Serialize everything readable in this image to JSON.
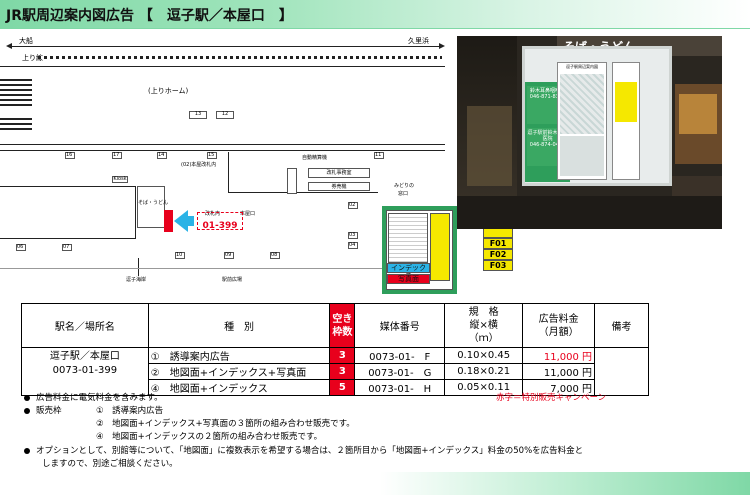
{
  "header": {
    "title": "JR駅周辺案内図広告 【　逗子駅／本屋口　】"
  },
  "map": {
    "dir_left": "大船",
    "dir_right": "久里浜",
    "track_label": "上り線",
    "platform_label": "(上りホーム)",
    "num_12": "12",
    "num_13": "13",
    "num_16": "16",
    "num_17": "17",
    "num_14": "14",
    "num_15": "15",
    "num_11": "11",
    "num_02": "02",
    "num_10": "10",
    "num_09": "09",
    "num_08": "08",
    "num_03": "03",
    "num_04": "04",
    "num_06": "06",
    "num_07": "07",
    "gate_label": "(02)本屋改札内",
    "jidou": "自動精算機",
    "midori_top": "緑窓",
    "kaisatsu_office": "改札事務室",
    "ticket_machine": "券売機",
    "kiosk": "Kiosk",
    "soba": "そば・うどん",
    "honya": "本屋口",
    "gate_inside": "改札内",
    "midori1": "みどりの",
    "midori2": "窓口",
    "ad_code": "01-399",
    "coast": "逗子海岸",
    "plaza": "駅前広場"
  },
  "diagram": {
    "index_label": "インデックス",
    "photo_label": "写真面",
    "board_header": "逗子駅周辺案内",
    "f01": "F01",
    "f02": "F02",
    "f03": "F03"
  },
  "photo": {
    "sign_text": "そば・うどん",
    "clinic1": "鈴木耳鼻咽喉科",
    "clinic2": "逗子駅前鈴木眼科医院",
    "phone1": "046-871-8312",
    "phone2": "046-874-0404",
    "board_title": "逗子駅周辺案内図"
  },
  "table": {
    "headers": {
      "station": "駅名／場所名",
      "kind": "種　別",
      "vacant1": "空き",
      "vacant2": "枠数",
      "media": "媒体番号",
      "size1": "規　格",
      "size2": "縦×横",
      "size3": "（ｍ）",
      "price1": "広告料金",
      "price2": "（月額）",
      "remarks": "備考"
    },
    "station_name": "逗子駅／本屋口",
    "station_code": "0073-01-399",
    "rows": [
      {
        "kind": "①　誘導案内広告",
        "vacant": "3",
        "media": "0073-01-　F",
        "size": "0.10×0.45",
        "price": "11,000 円",
        "price_red": true
      },
      {
        "kind": "②　地図面+インデックス+写真面",
        "vacant": "3",
        "media": "0073-01-　G",
        "size": "0.18×0.21",
        "price": "11,000 円",
        "price_red": false
      },
      {
        "kind": "④　地図面+インデックス",
        "vacant": "5",
        "media": "0073-01-　H",
        "size": "0.05×0.11",
        "price": "7,000 円",
        "price_red": false
      }
    ]
  },
  "notes": {
    "n1": "広告料金に電気料金を含みます。",
    "campaign": "赤字＝特別販売キャンペーン",
    "n2": "販売枠",
    "n2a": "①　誘導案内広告",
    "n2b": "②　地図面+インデックス+写真面の３箇所の組み合わせ販売です。",
    "n2c": "④　地図面+インデックスの２箇所の組み合わせ販売です。",
    "n3a": "オプションとして、別館等について、「地図面」に複数表示を希望する場合は、２箇所目から「地図面+インデックス」料金の50%を広告料金と",
    "n3b": "しますので、別途ご相談ください。"
  },
  "colors": {
    "accent_red": "#e8001c",
    "green": "#2e9e5b",
    "cyan": "#2bb3e6",
    "yellow": "#f5e800"
  }
}
